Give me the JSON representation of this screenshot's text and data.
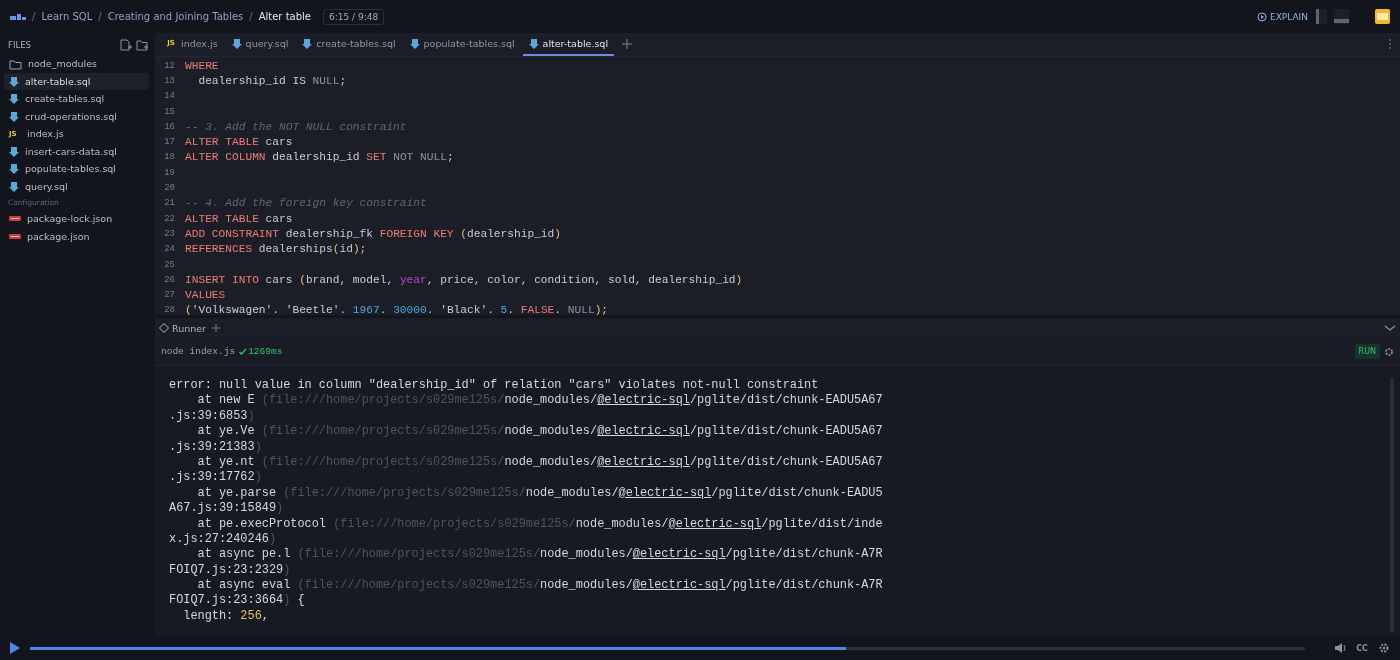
{
  "topbar": {
    "breadcrumbs": [
      "Learn SQL",
      "Creating and Joining Tables",
      "Alter table"
    ],
    "separator": "/",
    "time": "6:15 / 9:48",
    "explain": "EXPLAIN"
  },
  "sidebar": {
    "title": "FILES",
    "files": [
      {
        "name": "node_modules",
        "kind": "folder",
        "selected": false
      },
      {
        "name": "alter-table.sql",
        "kind": "sql",
        "selected": true
      },
      {
        "name": "create-tables.sql",
        "kind": "sql",
        "selected": false
      },
      {
        "name": "crud-operations.sql",
        "kind": "sql",
        "selected": false
      },
      {
        "name": "index.js",
        "kind": "js",
        "badge": "JS",
        "selected": false
      },
      {
        "name": "insert-cars-data.sql",
        "kind": "sql",
        "selected": false
      },
      {
        "name": "populate-tables.sql",
        "kind": "sql",
        "selected": false
      },
      {
        "name": "query.sql",
        "kind": "sql",
        "selected": false
      }
    ],
    "config_title": "Configuration",
    "config_files": [
      {
        "name": "package-lock.json",
        "kind": "json",
        "selected": false
      },
      {
        "name": "package.json",
        "kind": "json",
        "selected": false
      }
    ]
  },
  "editor": {
    "tabs": [
      {
        "label": "index.js",
        "kind": "js",
        "badge": "JS",
        "selected": false
      },
      {
        "label": "query.sql",
        "kind": "sql",
        "selected": false
      },
      {
        "label": "create-tables.sql",
        "kind": "sql",
        "selected": false
      },
      {
        "label": "populate-tables.sql",
        "kind": "sql",
        "selected": false
      },
      {
        "label": "alter-table.sql",
        "kind": "sql",
        "selected": true
      }
    ],
    "lines": [
      {
        "number": "12",
        "tokens": [
          {
            "text": "WHERE",
            "kind": "kw"
          }
        ]
      },
      {
        "number": "13",
        "tokens": [
          {
            "text": "  dealership_id IS ",
            "kind": "id"
          },
          {
            "text": "NULL",
            "kind": "null"
          },
          {
            "text": ";",
            "kind": "id"
          }
        ]
      },
      {
        "number": "14"
      },
      {
        "number": "15"
      },
      {
        "number": "16",
        "tokens": [
          {
            "text": "-- 3. Add the NOT NULL constraint",
            "kind": "comment"
          }
        ]
      },
      {
        "number": "17",
        "tokens": [
          {
            "text": "ALTER TABLE",
            "kind": "kw"
          },
          {
            "text": " cars",
            "kind": "id"
          }
        ]
      },
      {
        "number": "18",
        "tokens": [
          {
            "text": "ALTER COLUMN",
            "kind": "kw"
          },
          {
            "text": " dealership_id ",
            "kind": "id"
          },
          {
            "text": "SET",
            "kind": "kw"
          },
          {
            "text": " NOT NULL",
            "kind": "null"
          },
          {
            "text": ";",
            "kind": "id"
          }
        ]
      },
      {
        "number": "19"
      },
      {
        "number": "20"
      },
      {
        "number": "21",
        "tokens": [
          {
            "text": "-- 4. Add the foreign key constraint",
            "kind": "comment"
          }
        ]
      },
      {
        "number": "22",
        "tokens": [
          {
            "text": "ALTER TABLE",
            "kind": "kw"
          },
          {
            "text": " cars",
            "kind": "id"
          }
        ]
      },
      {
        "number": "23",
        "tokens": [
          {
            "text": "ADD CONSTRAINT",
            "kind": "kw"
          },
          {
            "text": " dealership_fk ",
            "kind": "id"
          },
          {
            "text": "FOREIGN KEY ",
            "kind": "kw"
          },
          {
            "text": "(",
            "kind": "paren"
          },
          {
            "text": "dealership_id",
            "kind": "id"
          },
          {
            "text": ")",
            "kind": "paren"
          }
        ]
      },
      {
        "number": "24",
        "tokens": [
          {
            "text": "REFERENCES",
            "kind": "kw"
          },
          {
            "text": " dealerships",
            "kind": "id"
          },
          {
            "text": "(",
            "kind": "paren"
          },
          {
            "text": "id",
            "kind": "id"
          },
          {
            "text": ")",
            "kind": "paren"
          },
          {
            "text": ";",
            "kind": "id"
          }
        ]
      },
      {
        "number": "25"
      },
      {
        "number": "26",
        "tokens": [
          {
            "text": "INSERT INTO",
            "kind": "kw"
          },
          {
            "text": " cars ",
            "kind": "id"
          },
          {
            "text": "(",
            "kind": "paren"
          },
          {
            "text": "brand, model, ",
            "kind": "id"
          },
          {
            "text": "year",
            "kind": "fn"
          },
          {
            "text": ", price, color, condition, sold, dealership_id",
            "kind": "id"
          },
          {
            "text": ")",
            "kind": "paren"
          }
        ]
      },
      {
        "number": "27",
        "tokens": [
          {
            "text": "VALUES",
            "kind": "kw"
          }
        ]
      },
      {
        "number": "28",
        "tokens": [
          {
            "text": "(",
            "kind": "paren"
          },
          {
            "text": "'Volkswagen'. 'Beetle'. ",
            "kind": "id"
          },
          {
            "text": "1967",
            "kind": "num"
          },
          {
            "text": ". ",
            "kind": "id"
          },
          {
            "text": "30000",
            "kind": "num"
          },
          {
            "text": ". 'Black'. ",
            "kind": "id"
          },
          {
            "text": "5",
            "kind": "num"
          },
          {
            "text": ". ",
            "kind": "id"
          },
          {
            "text": "FALSE",
            "kind": "kw"
          },
          {
            "text": ". ",
            "kind": "id"
          },
          {
            "text": "NULL",
            "kind": "null"
          },
          {
            "text": ")",
            "kind": "paren"
          },
          {
            "text": ";",
            "kind": "id"
          }
        ]
      }
    ]
  },
  "runner": {
    "title": "Runner",
    "command": "node index.js",
    "duration": "1269ms",
    "run_label": "RUN",
    "output": [
      [
        {
          "text": "error: null value in column \"dealership_id\" of relation \"cars\" violates not-null constraint",
          "kind": "plain"
        }
      ],
      [
        {
          "text": "    at new E ",
          "kind": "plain"
        },
        {
          "text": "(file:///home/projects/s029me125s/",
          "kind": "dim"
        },
        {
          "text": "node_modules/",
          "kind": "plain"
        },
        {
          "text": "@electric-sql",
          "kind": "link"
        },
        {
          "text": "/pglite/dist/chunk-EADU5A67",
          "kind": "plain"
        }
      ],
      [
        {
          "text": ".js:39:6853",
          "kind": "plain"
        },
        {
          "text": ")",
          "kind": "dim"
        }
      ],
      [
        {
          "text": "    at ye.Ve ",
          "kind": "plain"
        },
        {
          "text": "(file:///home/projects/s029me125s/",
          "kind": "dim"
        },
        {
          "text": "node_modules/",
          "kind": "plain"
        },
        {
          "text": "@electric-sql",
          "kind": "link"
        },
        {
          "text": "/pglite/dist/chunk-EADU5A67",
          "kind": "plain"
        }
      ],
      [
        {
          "text": ".js:39:21383",
          "kind": "plain"
        },
        {
          "text": ")",
          "kind": "dim"
        }
      ],
      [
        {
          "text": "    at ye.nt ",
          "kind": "plain"
        },
        {
          "text": "(file:///home/projects/s029me125s/",
          "kind": "dim"
        },
        {
          "text": "node_modules/",
          "kind": "plain"
        },
        {
          "text": "@electric-sql",
          "kind": "link"
        },
        {
          "text": "/pglite/dist/chunk-EADU5A67",
          "kind": "plain"
        }
      ],
      [
        {
          "text": ".js:39:17762",
          "kind": "plain"
        },
        {
          "text": ")",
          "kind": "dim"
        }
      ],
      [
        {
          "text": "    at ye.parse ",
          "kind": "plain"
        },
        {
          "text": "(file:///home/projects/s029me125s/",
          "kind": "dim"
        },
        {
          "text": "node_modules/",
          "kind": "plain"
        },
        {
          "text": "@electric-sql",
          "kind": "link"
        },
        {
          "text": "/pglite/dist/chunk-EADU5",
          "kind": "plain"
        }
      ],
      [
        {
          "text": "A67.js:39:15849",
          "kind": "plain"
        },
        {
          "text": ")",
          "kind": "dim"
        }
      ],
      [
        {
          "text": "    at pe.execProtocol ",
          "kind": "plain"
        },
        {
          "text": "(file:///home/projects/s029me125s/",
          "kind": "dim"
        },
        {
          "text": "node_modules/",
          "kind": "plain"
        },
        {
          "text": "@electric-sql",
          "kind": "link"
        },
        {
          "text": "/pglite/dist/inde",
          "kind": "plain"
        }
      ],
      [
        {
          "text": "x.js:27:240246",
          "kind": "plain"
        },
        {
          "text": ")",
          "kind": "dim"
        }
      ],
      [
        {
          "text": "    at async pe.l ",
          "kind": "plain"
        },
        {
          "text": "(file:///home/projects/s029me125s/",
          "kind": "dim"
        },
        {
          "text": "node_modules/",
          "kind": "plain"
        },
        {
          "text": "@electric-sql",
          "kind": "link"
        },
        {
          "text": "/pglite/dist/chunk-A7R",
          "kind": "plain"
        }
      ],
      [
        {
          "text": "FOIQ7.js:23:2329",
          "kind": "plain"
        },
        {
          "text": ")",
          "kind": "dim"
        }
      ],
      [
        {
          "text": "    at async eval ",
          "kind": "plain"
        },
        {
          "text": "(file:///home/projects/s029me125s/",
          "kind": "dim"
        },
        {
          "text": "node_modules/",
          "kind": "plain"
        },
        {
          "text": "@electric-sql",
          "kind": "link"
        },
        {
          "text": "/pglite/dist/chunk-A7R",
          "kind": "plain"
        }
      ],
      [
        {
          "text": "FOIQ7.js:23:3664",
          "kind": "plain"
        },
        {
          "text": ")",
          "kind": "dim"
        },
        {
          "text": " {",
          "kind": "plain"
        }
      ],
      [
        {
          "text": "  length: ",
          "kind": "plain"
        },
        {
          "text": "256",
          "kind": "num"
        },
        {
          "text": ",",
          "kind": "plain"
        }
      ]
    ]
  },
  "player": {
    "level": 0.64,
    "cc": "CC"
  }
}
